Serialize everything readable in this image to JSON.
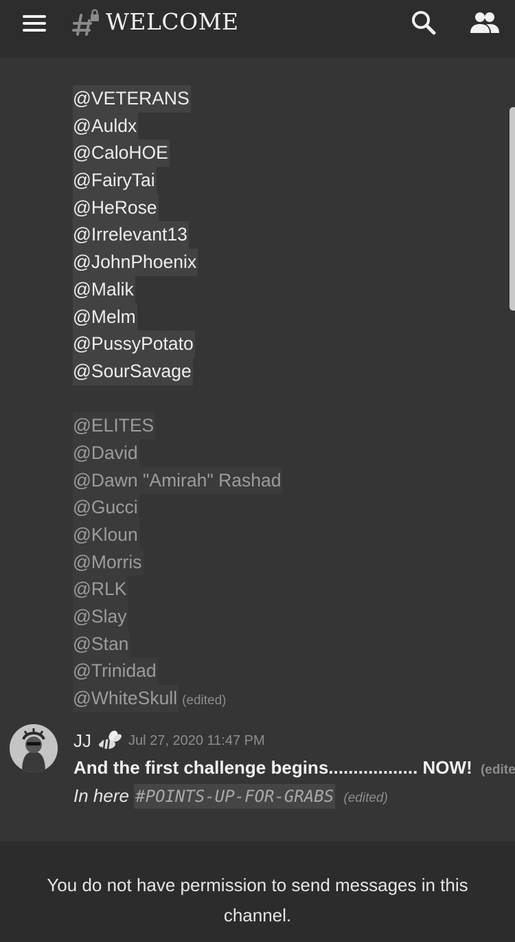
{
  "header": {
    "channel_title": "WELCOME",
    "icons": [
      "menu-icon",
      "locked-channel-hash-icon",
      "search-icon",
      "members-icon"
    ]
  },
  "veterans": [
    "@VETERANS",
    "@Auldx",
    "@CaloHOE",
    "@FairyTai",
    "@HeRose",
    "@Irrelevant13",
    "@JohnPhoenix",
    "@Malik",
    "@Melm",
    "@PussyPotato",
    "@SourSavage"
  ],
  "elites": [
    "@ELITES",
    "@David",
    "@Dawn \"Amirah\" Rashad",
    "@Gucci",
    "@Kloun",
    "@Morris",
    "@RLK",
    "@Slay",
    "@Stan",
    "@Trinidad",
    "@WhiteSkull"
  ],
  "edited_label": "(edited)",
  "message": {
    "author": "JJ",
    "badge_icon": "bee-icon",
    "timestamp": "Jul 27, 2020 11:47 PM",
    "line1": "And the first challenge begins.................. NOW!",
    "line2_prefix": "In here ",
    "channel_mention": "#POINTS-UP-FOR-GRABS"
  },
  "footer": {
    "notice": "You do not have permission to send messages in this channel."
  },
  "colors": {
    "background": "#353535",
    "topbar": "#2d2d2d",
    "mention_highlight": "#424242",
    "muted_text": "#8c8c8c"
  }
}
